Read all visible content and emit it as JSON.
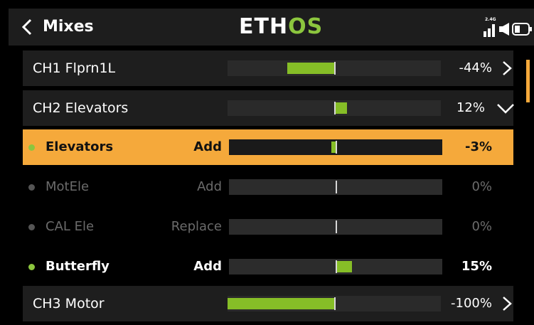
{
  "header": {
    "title": "Mixes",
    "logo_part1": "ETH",
    "logo_part2": "OS",
    "band": "2.4G"
  },
  "rows": {
    "ch1": {
      "name": "CH1 Flprn1L",
      "value": "-44%",
      "fraction": -0.44
    },
    "ch2": {
      "name": "CH2 Elevators",
      "value": "12%",
      "fraction": 0.12
    },
    "mix_elevators": {
      "label": "Elevators",
      "mode": "Add",
      "value": "-3%",
      "fraction": -0.03
    },
    "mix_motele": {
      "label": "MotEle",
      "mode": "Add",
      "value": "0%",
      "fraction": 0
    },
    "mix_calele": {
      "label": "CAL Ele",
      "mode": "Replace",
      "value": "0%",
      "fraction": 0
    },
    "mix_butterfly": {
      "label": "Butterfly",
      "mode": "Add",
      "value": "15%",
      "fraction": 0.15
    },
    "ch3": {
      "name": "CH3 Motor",
      "value": "-100%",
      "fraction": -1.0
    }
  },
  "colors": {
    "accent": "#f5a93b",
    "bar_fill": "#86be27",
    "logo_green": "#8cc63e"
  },
  "icons": [
    "back-chevron-icon",
    "signal-icon",
    "speaker-icon",
    "battery-icon",
    "chevron-right-icon",
    "chevron-down-icon"
  ]
}
